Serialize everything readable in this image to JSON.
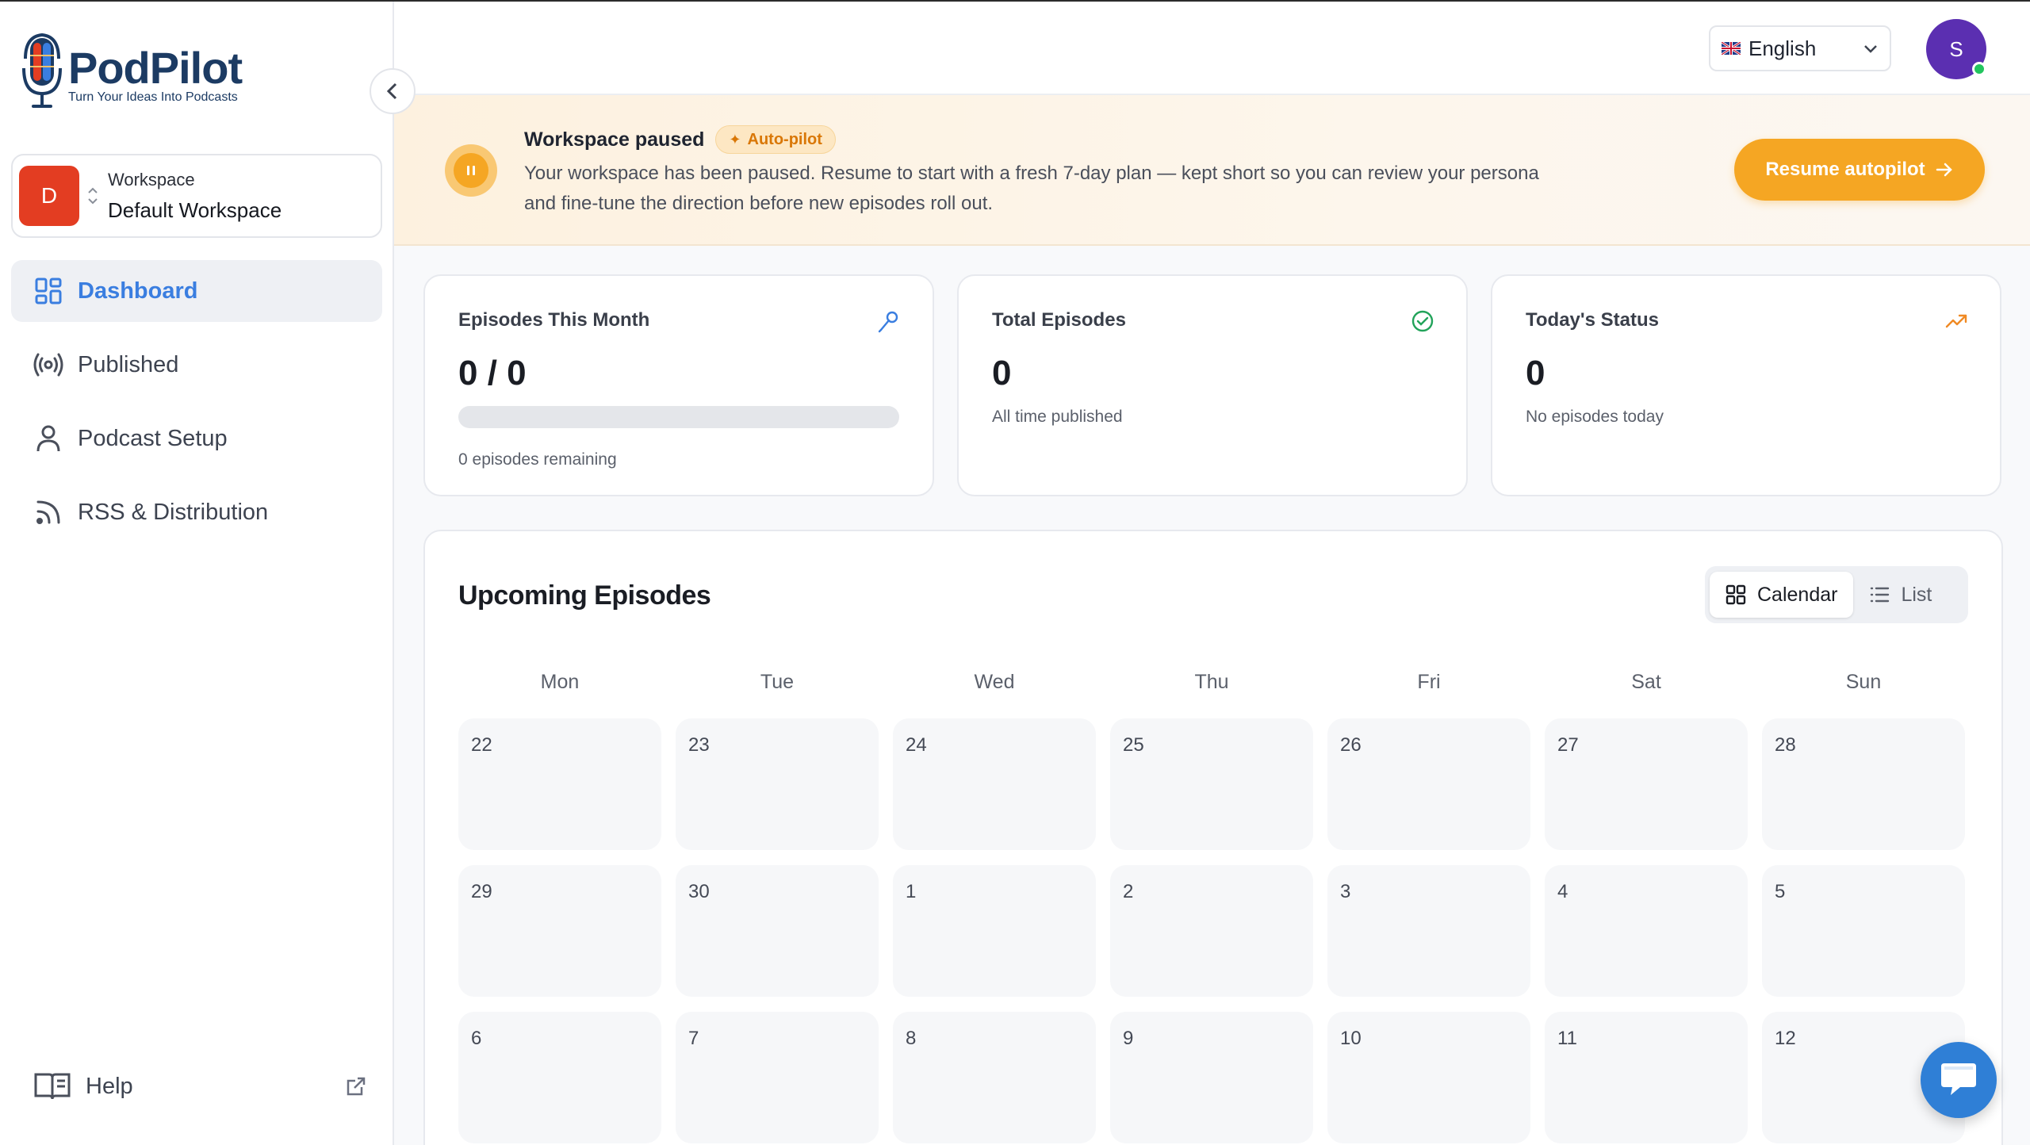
{
  "brand": {
    "name": "PodPilot",
    "tagline": "Turn Your Ideas Into Podcasts"
  },
  "workspace": {
    "avatar_letter": "D",
    "label": "Workspace",
    "name": "Default Workspace",
    "avatar_color": "#e33d22"
  },
  "sidebar": {
    "items": [
      {
        "label": "Dashboard",
        "icon": "grid-icon",
        "active": true
      },
      {
        "label": "Published",
        "icon": "broadcast-icon",
        "active": false
      },
      {
        "label": "Podcast Setup",
        "icon": "user-icon",
        "active": false
      },
      {
        "label": "RSS & Distribution",
        "icon": "rss-icon",
        "active": false
      }
    ],
    "help_label": "Help"
  },
  "header": {
    "language": "English",
    "user_initial": "S",
    "user_color": "#5b2fb1"
  },
  "banner": {
    "title": "Workspace paused",
    "pill": "Auto-pilot",
    "description": "Your workspace has been paused. Resume to start with a fresh 7-day plan — kept short so you can review your persona and fine-tune the direction before new episodes roll out.",
    "button": "Resume autopilot",
    "accent": "#f5a623"
  },
  "stats": [
    {
      "title": "Episodes This Month",
      "value": "0 / 0",
      "sub": "0 episodes remaining",
      "icon": "microphone-icon",
      "progress": 0
    },
    {
      "title": "Total Episodes",
      "value": "0",
      "sub": "All time published",
      "icon": "check-circle-icon"
    },
    {
      "title": "Today's Status",
      "value": "0",
      "sub": "No episodes today",
      "icon": "trending-up-icon"
    }
  ],
  "calendar": {
    "title": "Upcoming Episodes",
    "views": [
      "Calendar",
      "List"
    ],
    "active_view": "Calendar",
    "weekdays": [
      "Mon",
      "Tue",
      "Wed",
      "Thu",
      "Fri",
      "Sat",
      "Sun"
    ],
    "weeks": [
      [
        "22",
        "23",
        "24",
        "25",
        "26",
        "27",
        "28"
      ],
      [
        "29",
        "30",
        "1",
        "2",
        "3",
        "4",
        "5"
      ],
      [
        "6",
        "7",
        "8",
        "9",
        "10",
        "11",
        "12"
      ]
    ]
  }
}
